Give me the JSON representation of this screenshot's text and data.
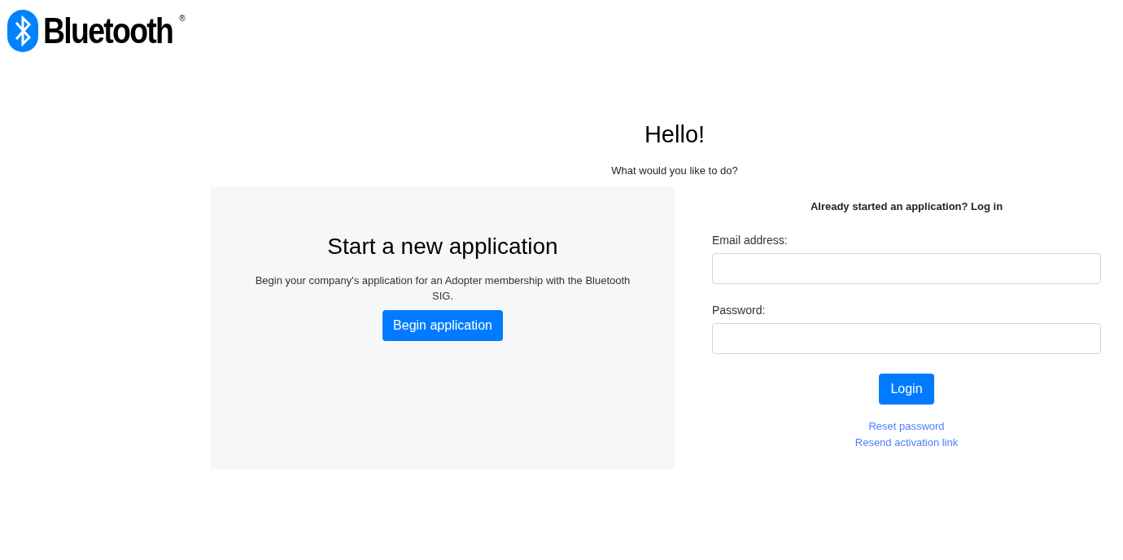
{
  "logo": {
    "wordmark": "Bluetooth",
    "mark": "®"
  },
  "heading": "Hello!",
  "subheading": "What would you like to do?",
  "new_application": {
    "title": "Start a new application",
    "description": "Begin your company's application for an Adopter membership with the Bluetooth SIG.",
    "button": "Begin application"
  },
  "login": {
    "title": "Already started an application? Log in",
    "fields": [
      {
        "label": "Email address:"
      },
      {
        "label": "Password:"
      }
    ],
    "button": "Login",
    "links": [
      "Reset password",
      "Resend activation link"
    ]
  }
}
